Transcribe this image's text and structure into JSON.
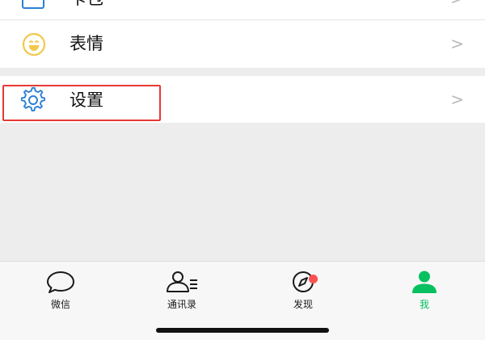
{
  "menu": {
    "partial_label": "卡包",
    "emoji_label": "表情",
    "settings_label": "设置",
    "chevron": ">"
  },
  "tabbar": {
    "items": [
      {
        "label": "微信",
        "icon": "chat-bubble-icon",
        "active": false
      },
      {
        "label": "通讯录",
        "icon": "contacts-icon",
        "active": false
      },
      {
        "label": "发现",
        "icon": "compass-icon",
        "active": false,
        "badge": true
      },
      {
        "label": "我",
        "icon": "person-icon",
        "active": true
      }
    ]
  },
  "colors": {
    "accent": "#07c160",
    "badge": "#fa5151",
    "highlight": "#e53935",
    "settings_icon": "#2b7fd6",
    "emoji_icon": "#f2c94c"
  }
}
